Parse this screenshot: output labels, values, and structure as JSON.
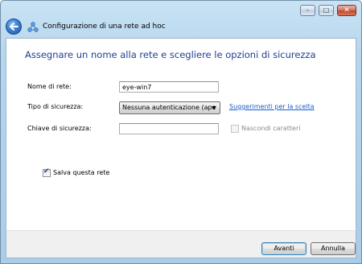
{
  "window": {
    "title": "Configurazione di una rete ad hoc",
    "controls": {
      "minimize": "–",
      "maximize": "□",
      "close": "✕"
    }
  },
  "page": {
    "main_instruction": "Assegnare un nome alla rete e scegliere le opzioni di sicurezza"
  },
  "form": {
    "network_name": {
      "label": "Nome di rete:",
      "value": "eye-win7"
    },
    "security_type": {
      "label": "Tipo di sicurezza:",
      "selected": "Nessuna autenticazione (ape"
    },
    "help_link": "Suggerimenti per la scelta",
    "security_key": {
      "label": "Chiave di sicurezza:",
      "value": ""
    },
    "hide_chars": {
      "label": "Nascondi caratteri",
      "checked": false,
      "enabled": false
    },
    "save_network": {
      "label": "Salva questa rete",
      "checked": true
    }
  },
  "buttons": {
    "next": "Avanti",
    "cancel": "Annulla"
  },
  "icons": {
    "back": "back-arrow-icon",
    "network": "adhoc-network-icon"
  },
  "colors": {
    "instruction": "#1c3e94",
    "link": "#1c5cc2"
  }
}
